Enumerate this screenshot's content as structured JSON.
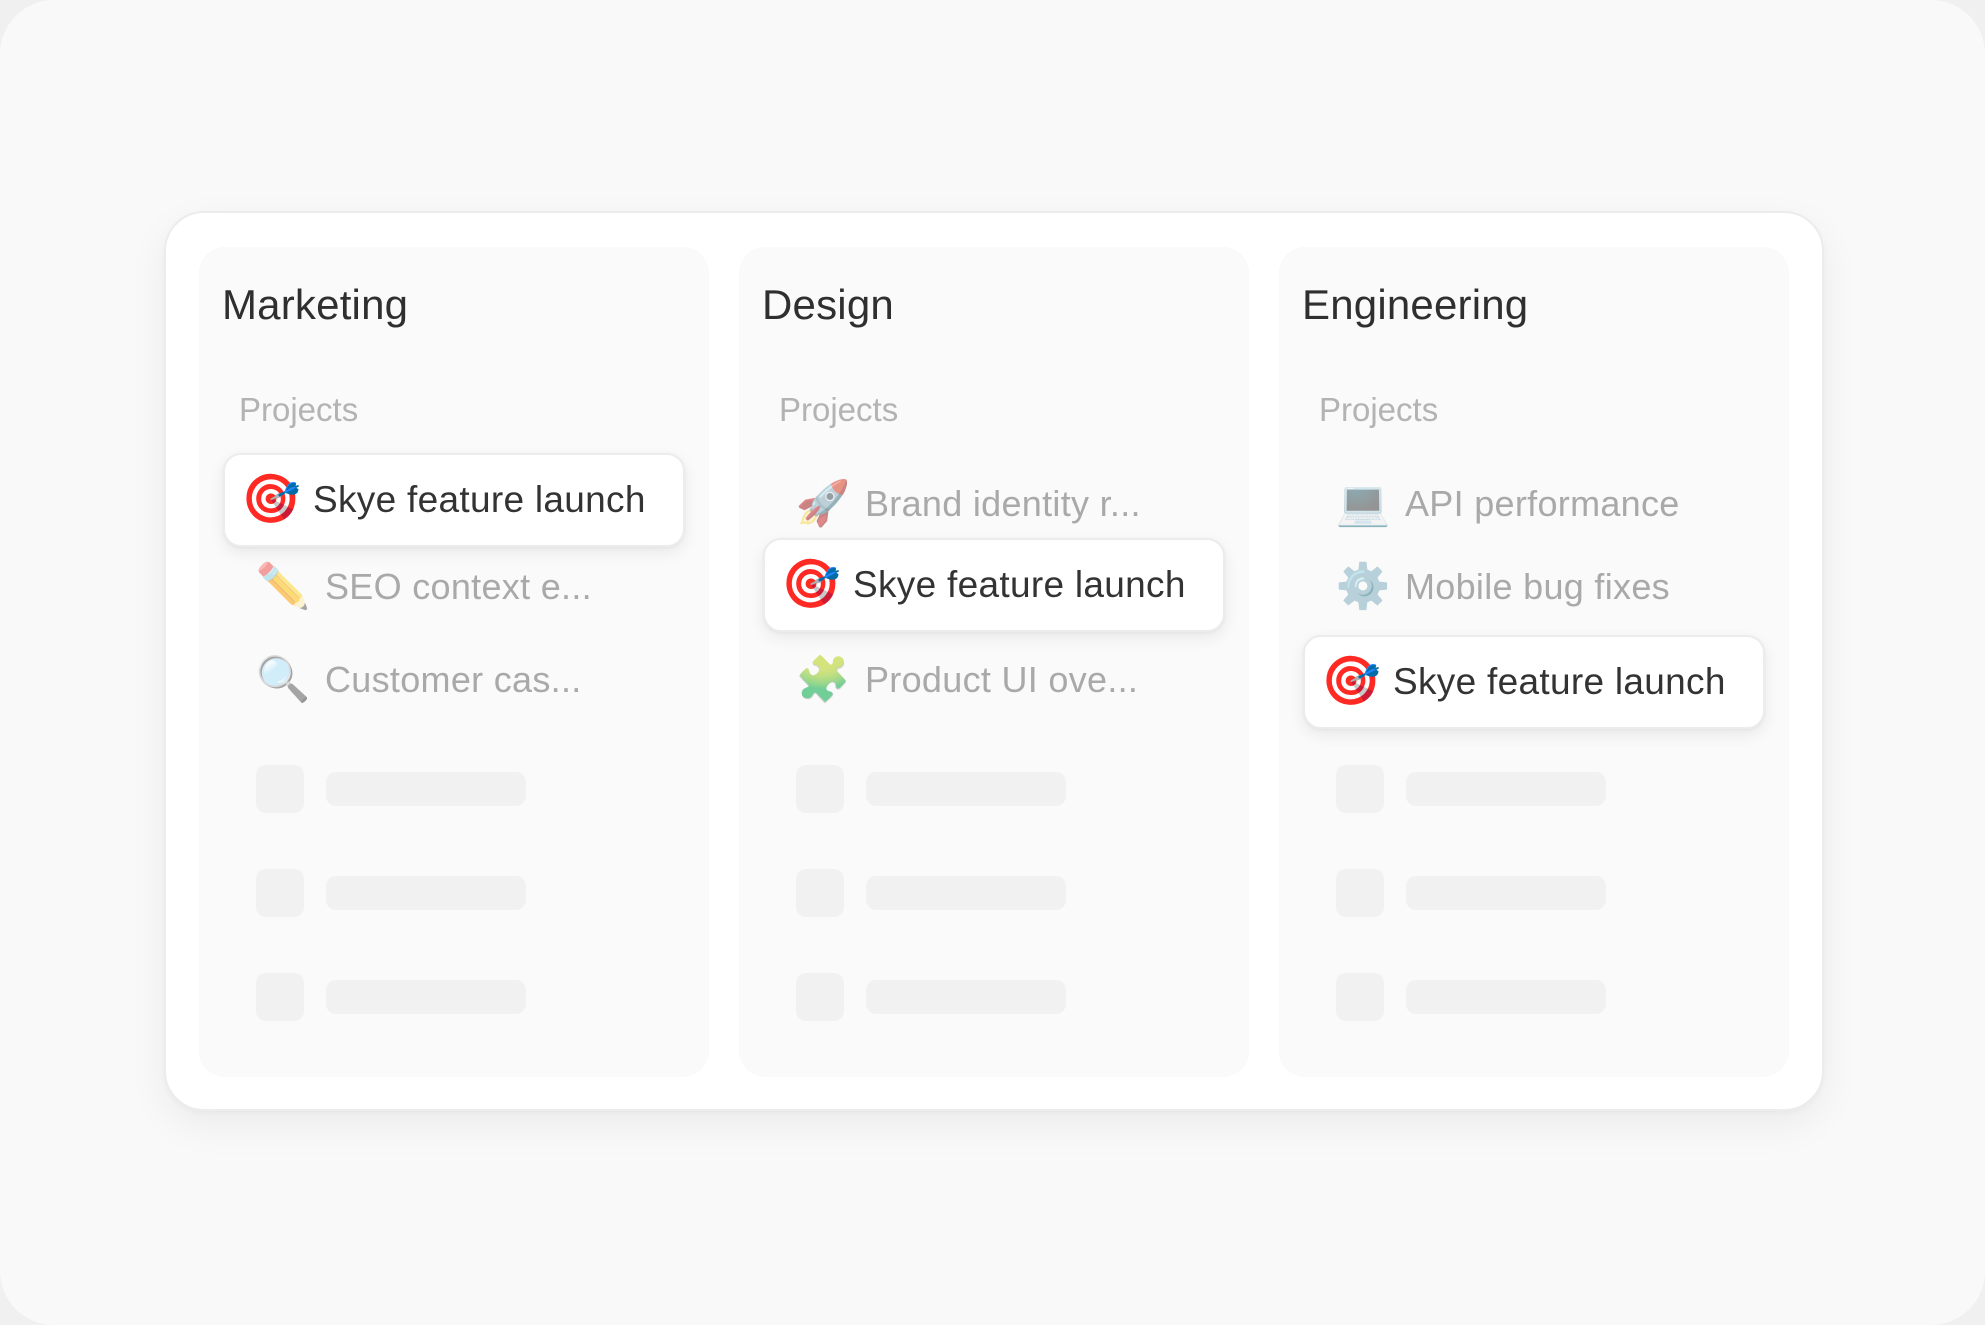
{
  "columns": [
    {
      "title": "Marketing",
      "section_label": "Projects",
      "selected": {
        "emoji": "🎯",
        "icon_name": "target-dart-icon",
        "label": "Skye feature launch"
      },
      "items": [
        {
          "emoji": "✏️",
          "icon_name": "pencil-icon",
          "label": "SEO context e..."
        },
        {
          "emoji": "🔍",
          "icon_name": "magnifier-icon",
          "label": "Customer cas..."
        }
      ]
    },
    {
      "title": "Design",
      "section_label": "Projects",
      "selected": {
        "emoji": "🎯",
        "icon_name": "target-dart-icon",
        "label": "Skye feature launch"
      },
      "items": [
        {
          "emoji": "🚀",
          "icon_name": "rocket-icon",
          "label": "Brand identity r..."
        },
        {
          "emoji": "🧩",
          "icon_name": "puzzle-piece-icon",
          "label": "Product UI ove..."
        }
      ]
    },
    {
      "title": "Engineering",
      "section_label": "Projects",
      "selected": {
        "emoji": "🎯",
        "icon_name": "target-dart-icon",
        "label": "Skye feature launch"
      },
      "items": [
        {
          "emoji": "💻",
          "icon_name": "laptop-icon",
          "label": "API performance"
        },
        {
          "emoji": "⚙️",
          "icon_name": "gear-icon",
          "label": "Mobile bug fixes"
        }
      ]
    }
  ]
}
